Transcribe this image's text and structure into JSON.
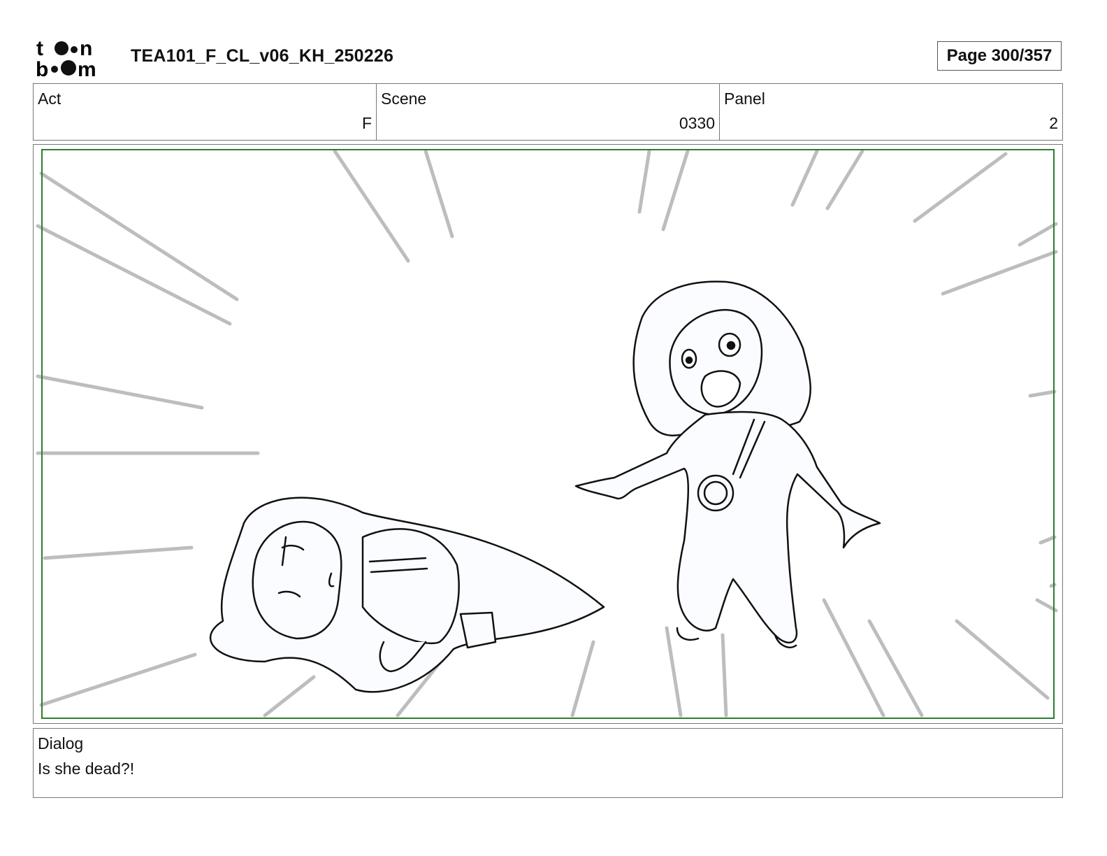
{
  "header": {
    "logo_text": [
      "t",
      "n",
      "b",
      "m"
    ],
    "document_title": "TEA101_F_CL_v06_KH_250226",
    "page_indicator": "Page 300/357"
  },
  "info": {
    "act": {
      "label": "Act",
      "value": "F"
    },
    "scene": {
      "label": "Scene",
      "value": "0330"
    },
    "panel": {
      "label": "Panel",
      "value": "2"
    }
  },
  "frame": {
    "safe_frame_color": "#2e7d32"
  },
  "dialog": {
    "label": "Dialog",
    "text": "Is she dead?!"
  }
}
